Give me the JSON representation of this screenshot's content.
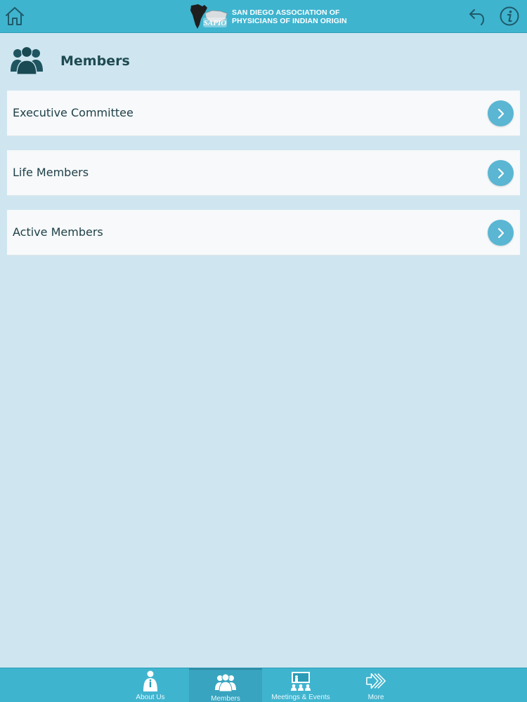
{
  "header": {
    "logo_line1": "SAN DIEGO ASSOCIATION OF",
    "logo_line2": "PHYSICIANS OF INDIAN ORIGIN",
    "logo_badge": "SAPIO"
  },
  "page": {
    "title": "Members"
  },
  "list": {
    "items": [
      {
        "label": "Executive Committee"
      },
      {
        "label": "Life Members"
      },
      {
        "label": "Active Members"
      }
    ]
  },
  "tabbar": {
    "tabs": [
      {
        "label": "About Us",
        "active": false
      },
      {
        "label": "Members",
        "active": true
      },
      {
        "label": "Meetings & Events",
        "active": false
      },
      {
        "label": "More",
        "active": false
      }
    ]
  },
  "colors": {
    "header_bg": "#3fb4cf",
    "page_bg": "#cfe6f0",
    "chevron_bg": "#5ab6d3",
    "title_text": "#1f4a52"
  }
}
